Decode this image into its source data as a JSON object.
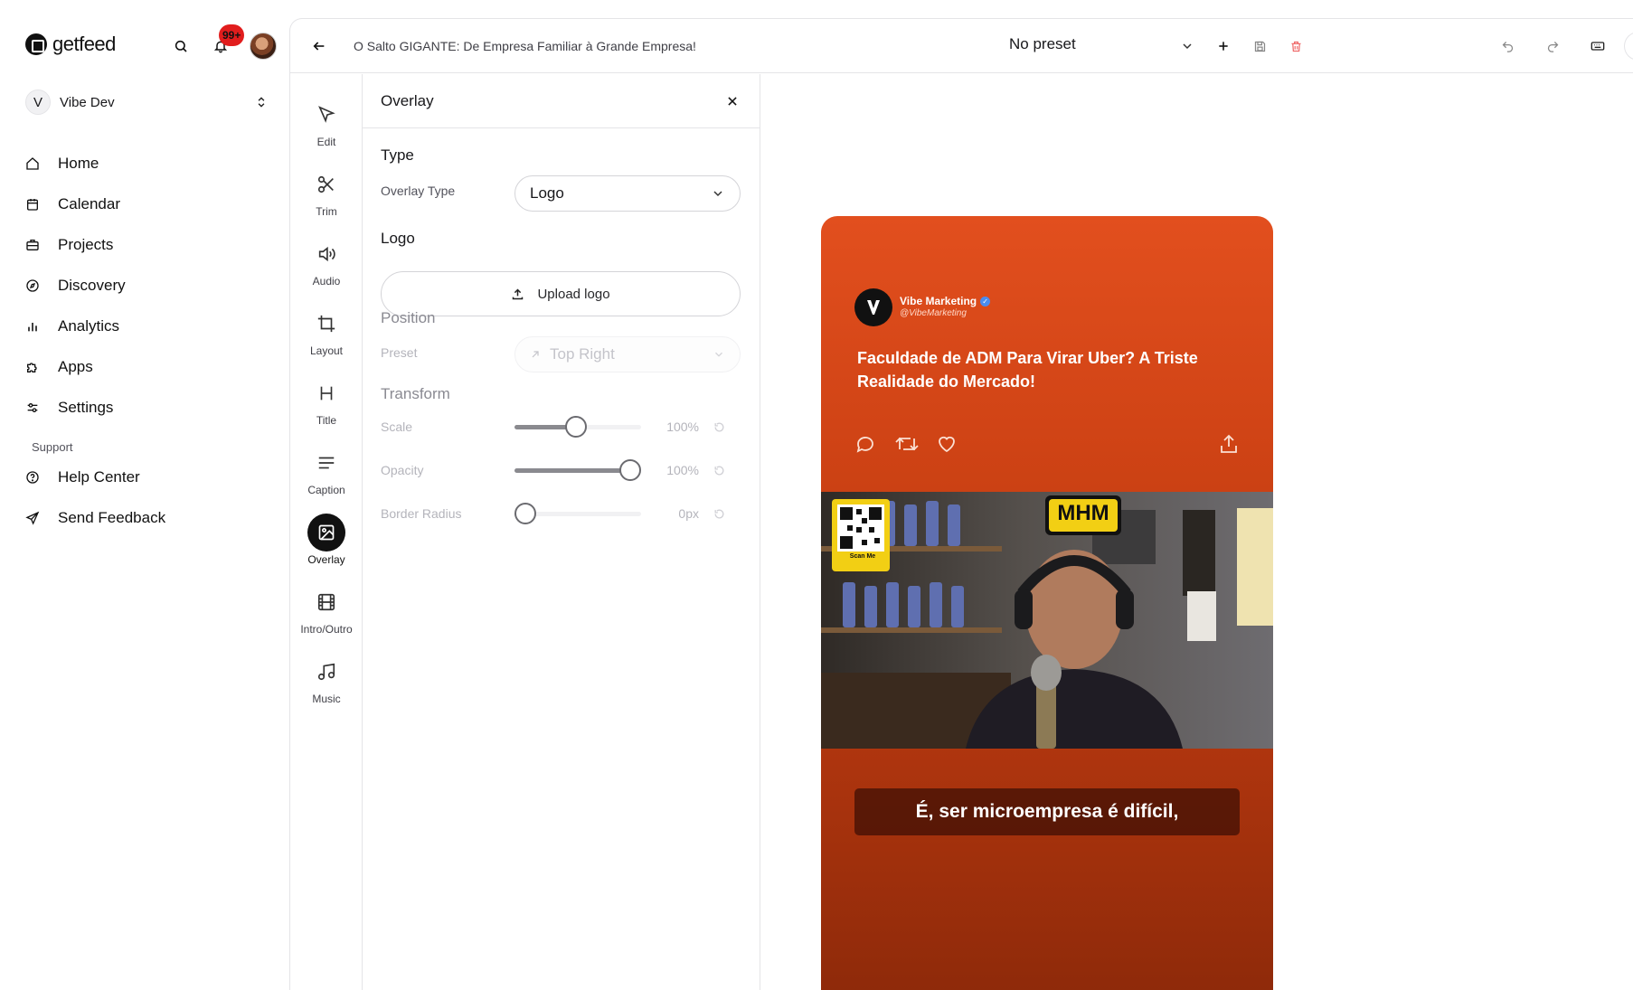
{
  "brand": {
    "name": "getfeed"
  },
  "notifications": {
    "count": "99+"
  },
  "workspace": {
    "initial": "V",
    "name": "Vibe Dev"
  },
  "nav": {
    "items": [
      {
        "label": "Home",
        "icon": "home-icon"
      },
      {
        "label": "Calendar",
        "icon": "calendar-icon"
      },
      {
        "label": "Projects",
        "icon": "briefcase-icon"
      },
      {
        "label": "Discovery",
        "icon": "compass-icon"
      },
      {
        "label": "Analytics",
        "icon": "bar-chart-icon"
      },
      {
        "label": "Apps",
        "icon": "puzzle-icon"
      },
      {
        "label": "Settings",
        "icon": "sliders-icon"
      }
    ],
    "support_label": "Support",
    "support_items": [
      {
        "label": "Help Center",
        "icon": "help-circle-icon"
      },
      {
        "label": "Send Feedback",
        "icon": "send-icon"
      }
    ]
  },
  "editor": {
    "title": "O Salto GIGANTE: De Empresa Familiar à Grande Empresa!",
    "preset": "No preset"
  },
  "tools": [
    {
      "label": "Edit",
      "icon": "cursor-icon"
    },
    {
      "label": "Trim",
      "icon": "scissors-icon"
    },
    {
      "label": "Audio",
      "icon": "volume-icon"
    },
    {
      "label": "Layout",
      "icon": "crop-icon"
    },
    {
      "label": "Title",
      "icon": "heading-icon"
    },
    {
      "label": "Caption",
      "icon": "text-lines-icon"
    },
    {
      "label": "Overlay",
      "icon": "image-icon",
      "active": true
    },
    {
      "label": "Intro/Outro",
      "icon": "film-icon"
    },
    {
      "label": "Music",
      "icon": "music-icon"
    }
  ],
  "overlay_panel": {
    "title": "Overlay",
    "type_section": "Type",
    "overlay_type_label": "Overlay Type",
    "overlay_type_value": "Logo",
    "logo_section": "Logo",
    "upload_label": "Upload logo",
    "position_section": "Position",
    "preset_label": "Preset",
    "preset_value": "Top Right",
    "transform_section": "Transform",
    "scale_label": "Scale",
    "scale_value": "100%",
    "scale_level": 0.48,
    "opacity_label": "Opacity",
    "opacity_value": "100%",
    "opacity_level": 1.0,
    "radius_label": "Border Radius",
    "radius_value": "0px",
    "radius_level": 0.0
  },
  "preview": {
    "account_name": "Vibe Marketing",
    "account_handle": "@VibeMarketing",
    "tweet_text": "Faculdade de ADM Para Virar Uber? A Triste Realidade do Mercado!",
    "caption": "É, ser microempresa é difícil,",
    "video_badge": "MHM",
    "qr_caption": "Scan Me",
    "colors": {
      "card_top": "#e24f1e",
      "card_bottom": "#8f2a0a",
      "accent": "#e11d1d"
    }
  }
}
